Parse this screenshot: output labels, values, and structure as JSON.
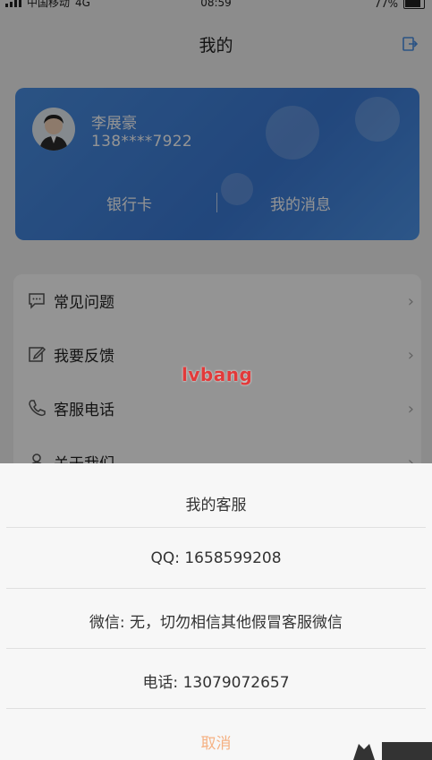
{
  "status_bar": {
    "carrier": "中国移动",
    "network": "4G",
    "time": "08:59",
    "battery": "77%"
  },
  "nav": {
    "title": "我的"
  },
  "user_card": {
    "name": "李展豪",
    "phone": "138****7922",
    "bank_card_label": "银行卡",
    "messages_label": "我的消息"
  },
  "menu": {
    "items": [
      {
        "label": "常见问题",
        "icon": "question-chat-icon"
      },
      {
        "label": "我要反馈",
        "icon": "edit-icon"
      },
      {
        "label": "客服电话",
        "icon": "phone-icon"
      },
      {
        "label": "关于我们",
        "icon": "person-icon"
      }
    ]
  },
  "watermark": {
    "text": "lvbang"
  },
  "service_sheet": {
    "title": "我的客服",
    "qq": "QQ: 1658599208",
    "wechat": "微信: 无，切勿相信其他假冒客服微信",
    "phone": "电话: 13079072657",
    "cancel": "取消"
  },
  "colors": {
    "card_blue": "#4a8fe3",
    "cancel_orange": "#f5b183",
    "watermark_red": "#e23a3a"
  }
}
